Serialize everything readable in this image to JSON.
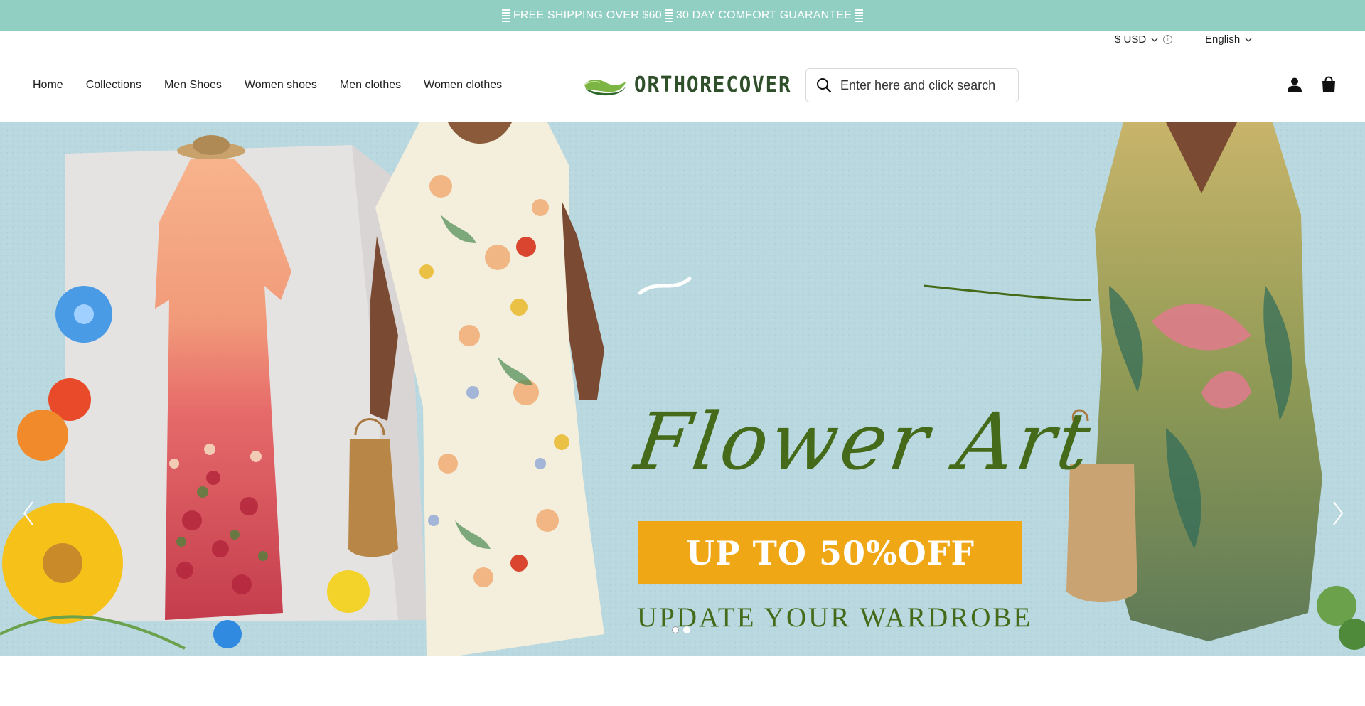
{
  "announcement": {
    "text_1": "FREE SHIPPING OVER $60",
    "text_2": "30 DAY COMFORT GUARANTEE"
  },
  "utility_bar": {
    "currency": "$ USD",
    "language": "English"
  },
  "nav": {
    "items": [
      {
        "label": "Home"
      },
      {
        "label": "Collections"
      },
      {
        "label": "Men Shoes"
      },
      {
        "label": "Women shoes"
      },
      {
        "label": "Men clothes"
      },
      {
        "label": "Women clothes"
      }
    ]
  },
  "logo": {
    "text": "ORTHORECOVER"
  },
  "search": {
    "placeholder": "Enter here and click search"
  },
  "hero": {
    "title": "Flower Art",
    "banner": "UP TO 50%OFF",
    "subtitle": "UPDATE YOUR WARDROBE",
    "slide_count": 2,
    "active_slide": 2
  },
  "colors": {
    "announcement_bg": "#92cfc3",
    "hero_bg": "#b9d8df",
    "banner_orange": "#f0a715",
    "headline_green": "#456b1a"
  },
  "icons": {
    "search": "search-icon",
    "account": "account-icon",
    "cart": "cart-icon",
    "prev": "chevron-left-icon",
    "next": "chevron-right-icon"
  }
}
